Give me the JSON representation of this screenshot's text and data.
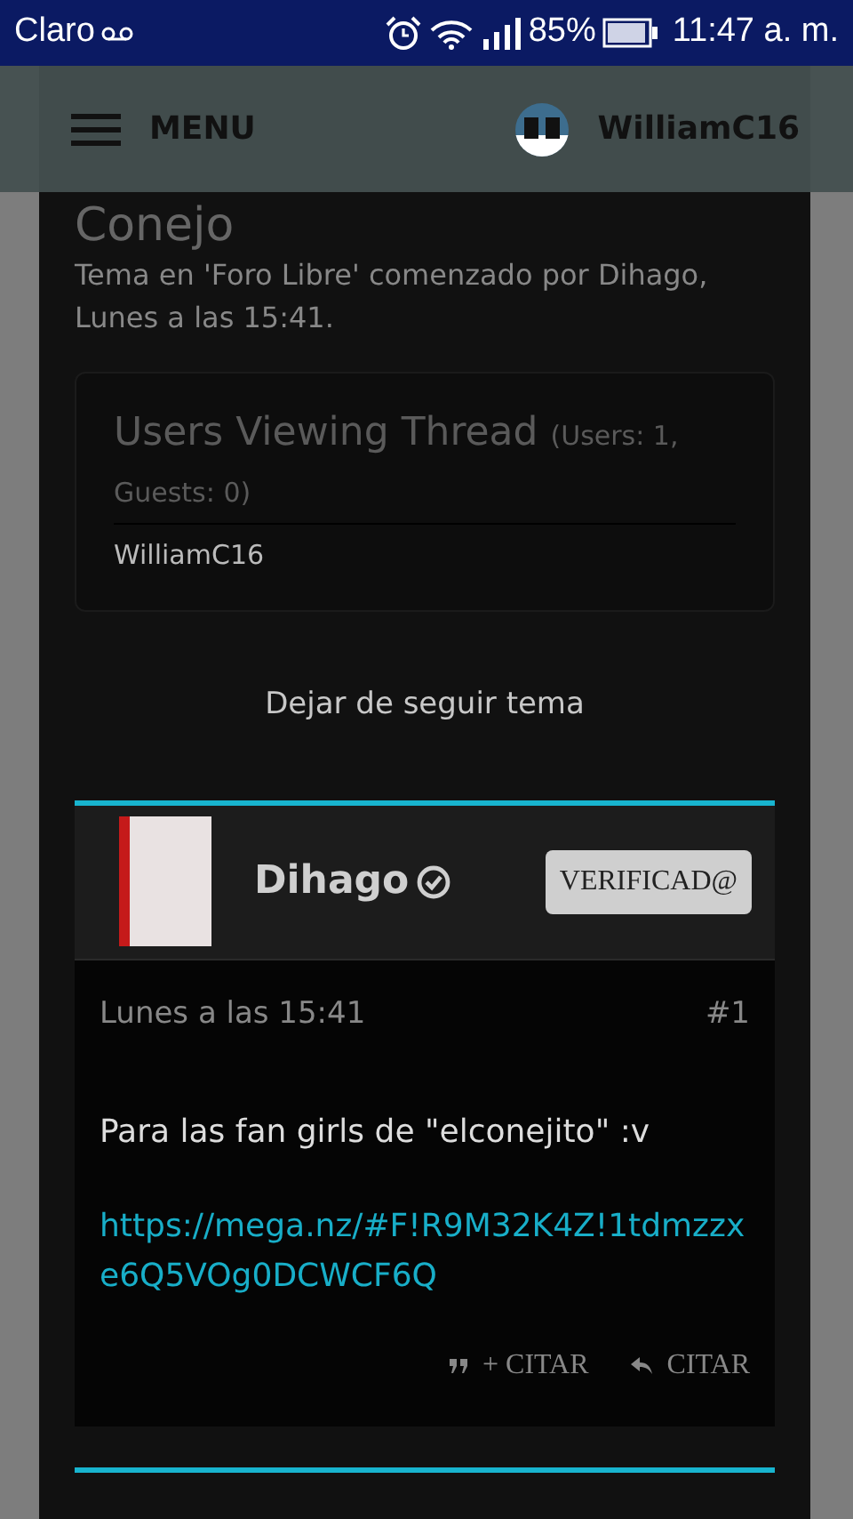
{
  "status_bar": {
    "carrier": "Claro",
    "battery": "85%",
    "time": "11:47 a. m."
  },
  "header": {
    "menu_label": "MENU",
    "username": "WilliamC16"
  },
  "thread": {
    "title": "Conejo",
    "meta": "Tema en 'Foro Libre' comenzado por Dihago, Lunes a las 15:41."
  },
  "users_viewing": {
    "title": "Users Viewing Thread",
    "counts": "(Users: 1, Guests: 0)",
    "users": [
      "WilliamC16"
    ]
  },
  "unwatch_link": "Dejar de seguir tema",
  "posts": [
    {
      "author": "Dihago",
      "verified": true,
      "badge": "VERIFICAD@",
      "date": "Lunes a las 15:41",
      "number": "#1",
      "message": "Para las fan girls de \"elconejito\" :v",
      "link": "https://mega.nz/#F!R9M32K4Z!1tdmzzxe6Q5VOg0DCWCF6Q",
      "actions": [
        {
          "kind": "multiquote",
          "label": "+ CITAR"
        },
        {
          "kind": "reply",
          "label": "CITAR"
        }
      ]
    }
  ]
}
